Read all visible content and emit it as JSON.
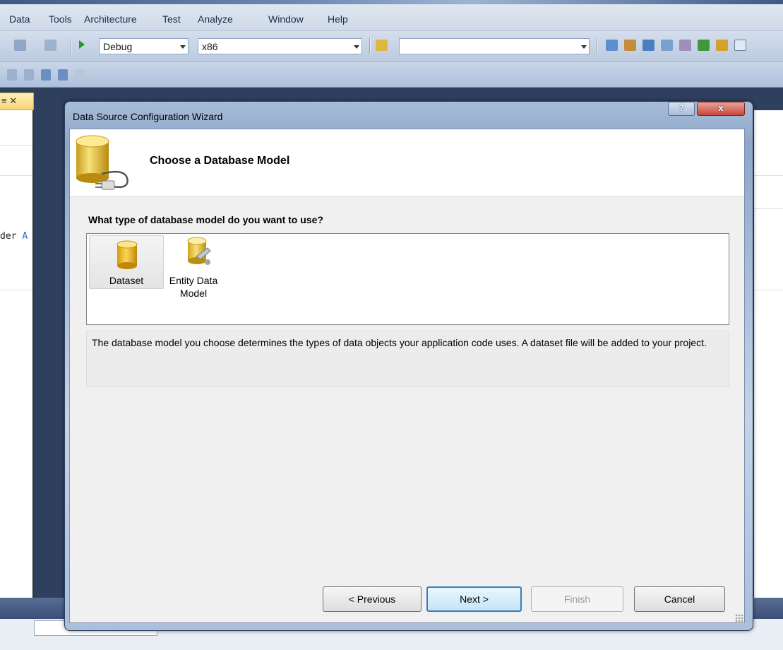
{
  "menu": [
    "Data",
    "Tools",
    "Architecture",
    "Test",
    "Analyze",
    "Window",
    "Help"
  ],
  "toolbar": {
    "config": "Debug",
    "platform": "x86",
    "find_value": ""
  },
  "ide": {
    "tab_label": "≡ ✕",
    "code_prefix": "der",
    "code_suffix": "A"
  },
  "wizard": {
    "title": "Data Source Configuration Wizard",
    "help_button": "?",
    "close_button": "x",
    "header_title": "Choose a Database Model",
    "question": "What type of database model do you want to use?",
    "options": [
      {
        "label": "Dataset",
        "selected": true
      },
      {
        "label": "Entity Data Model",
        "selected": false
      }
    ],
    "description": "The database model you choose determines the types of data objects your application code uses. A dataset file will be added to your project.",
    "buttons": {
      "previous": "< Previous",
      "next": "Next >",
      "finish": "Finish",
      "cancel": "Cancel"
    }
  }
}
